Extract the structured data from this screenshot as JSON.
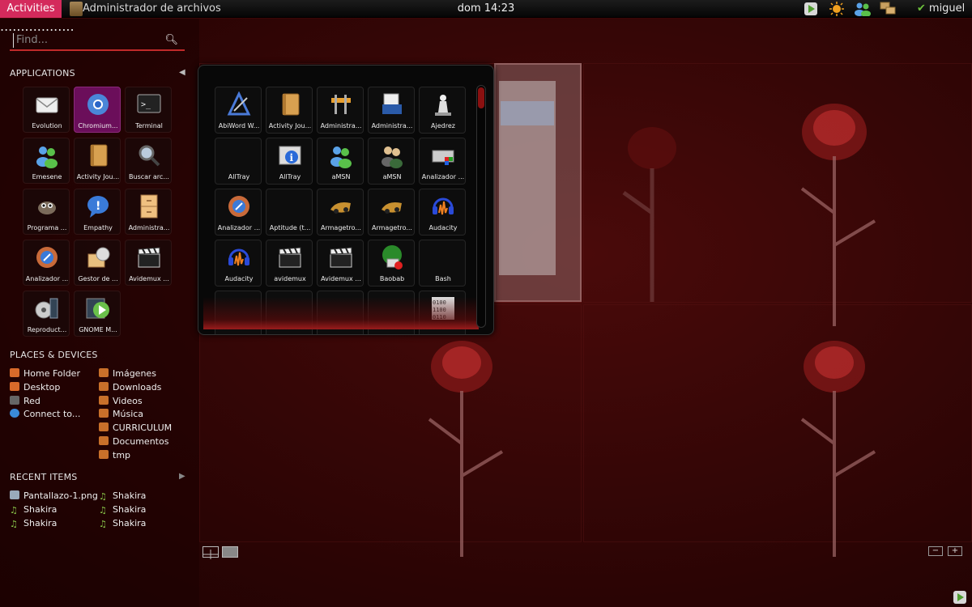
{
  "topbar": {
    "activities_label": "Activities",
    "app_title": "Administrador de archivos",
    "clock": "dom 14:23",
    "user": "miguel",
    "tray_icons": [
      "update-icon",
      "brightness-icon",
      "contacts-icon",
      "network-icon"
    ]
  },
  "search": {
    "placeholder": "Find..."
  },
  "sections": {
    "applications": "APPLICATIONS",
    "places": "PLACES & DEVICES",
    "recent": "RECENT ITEMS"
  },
  "apps": [
    {
      "label": "Evolution",
      "icon": "mail-icon"
    },
    {
      "label": "Chromium...",
      "icon": "chromium-icon"
    },
    {
      "label": "Terminal",
      "icon": "terminal-icon"
    },
    {
      "label": "Emesene",
      "icon": "messenger-icon"
    },
    {
      "label": "Activity Jou...",
      "icon": "journal-icon"
    },
    {
      "label": "Buscar arc...",
      "icon": "search-files-icon"
    },
    {
      "label": "Programa ...",
      "icon": "gimp-icon"
    },
    {
      "label": "Empathy",
      "icon": "empathy-icon"
    },
    {
      "label": "Administra...",
      "icon": "file-cabinet-icon"
    },
    {
      "label": "Analizador ...",
      "icon": "disk-analyzer-icon"
    },
    {
      "label": "Gestor de ...",
      "icon": "package-manager-icon"
    },
    {
      "label": "Avidemux ...",
      "icon": "clapperboard-icon"
    },
    {
      "label": "Reproduct...",
      "icon": "media-player-icon"
    },
    {
      "label": "GNOME M...",
      "icon": "gnome-mplayer-icon"
    }
  ],
  "places": [
    {
      "label": "Home Folder",
      "icon": "home-folder-icon"
    },
    {
      "label": "Desktop",
      "icon": "desktop-icon"
    },
    {
      "label": "Red",
      "icon": "network-icon"
    },
    {
      "label": "Connect to...",
      "icon": "globe-icon"
    },
    {
      "label": "Imágenes",
      "icon": "folder-icon"
    },
    {
      "label": "Downloads",
      "icon": "folder-icon"
    },
    {
      "label": "Videos",
      "icon": "folder-icon"
    },
    {
      "label": "Música",
      "icon": "folder-icon"
    },
    {
      "label": "CURRICULUM",
      "icon": "folder-icon"
    },
    {
      "label": "Documentos",
      "icon": "folder-icon"
    },
    {
      "label": "tmp",
      "icon": "folder-icon"
    }
  ],
  "recent": [
    {
      "label": "Pantallazo-1.png",
      "icon": "image-file-icon"
    },
    {
      "label": "Shakira",
      "icon": "music-file-icon"
    },
    {
      "label": "Shakira",
      "icon": "music-file-icon"
    },
    {
      "label": "Shakira",
      "icon": "music-file-icon"
    },
    {
      "label": "Shakira",
      "icon": "music-file-icon"
    },
    {
      "label": "Shakira",
      "icon": "music-file-icon"
    }
  ],
  "ellipsis": "...",
  "grid": [
    {
      "label": "AbiWord W...",
      "icon": "abiword-icon"
    },
    {
      "label": "Activity Jou...",
      "icon": "journal-icon"
    },
    {
      "label": "Administra...",
      "icon": "admin-tools-icon"
    },
    {
      "label": "Administra...",
      "icon": "admin-docs-icon"
    },
    {
      "label": "Ajedrez",
      "icon": "chess-icon"
    },
    {
      "label": "AllTray",
      "icon": ""
    },
    {
      "label": "AllTray",
      "icon": "info-icon"
    },
    {
      "label": "aMSN",
      "icon": "messenger-icon"
    },
    {
      "label": "aMSN",
      "icon": "users-icon"
    },
    {
      "label": "Analizador ...",
      "icon": "log-analyzer-icon"
    },
    {
      "label": "Analizador ...",
      "icon": "disk-analyzer-icon"
    },
    {
      "label": "Aptitude (t...",
      "icon": ""
    },
    {
      "label": "Armagetro...",
      "icon": "racer-icon"
    },
    {
      "label": "Armagetro...",
      "icon": "racer-icon"
    },
    {
      "label": "Audacity",
      "icon": "audacity-icon"
    },
    {
      "label": "Audacity",
      "icon": "audacity-icon"
    },
    {
      "label": "avidemux",
      "icon": "avidemux-icon"
    },
    {
      "label": "Avidemux ...",
      "icon": "clapperboard-icon"
    },
    {
      "label": "Baobab",
      "icon": "baobab-icon"
    },
    {
      "label": "Bash",
      "icon": ""
    },
    {
      "label": "",
      "icon": ""
    },
    {
      "label": "",
      "icon": ""
    },
    {
      "label": "",
      "icon": ""
    },
    {
      "label": "",
      "icon": ""
    },
    {
      "label": "",
      "icon": "binary-icon"
    }
  ],
  "colors": {
    "accent": "#d42a5c",
    "background": "#3a0606",
    "selected_tile": "#6b0e5a"
  }
}
